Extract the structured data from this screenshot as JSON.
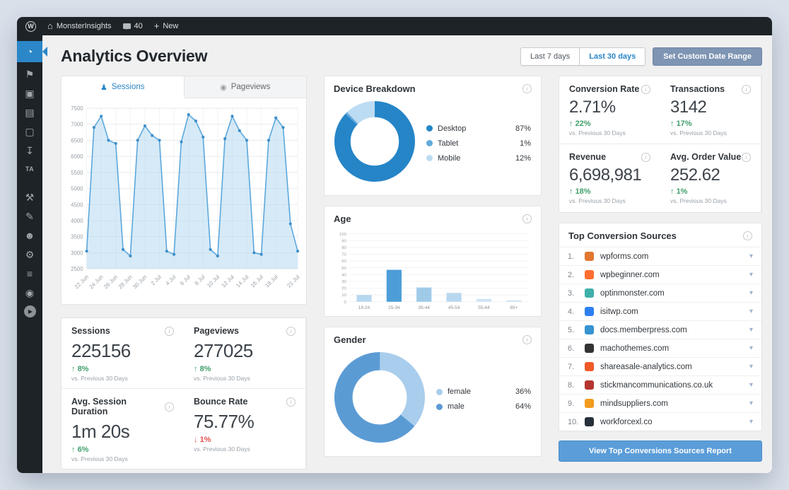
{
  "admin_bar": {
    "site_name": "MonsterInsights",
    "comments_count": "40",
    "new_label": "New"
  },
  "sidebar": {
    "items": [
      {
        "name": "monsterinsights",
        "glyph": "◔",
        "state": "active"
      },
      {
        "name": "posts-pin",
        "glyph": "⚑",
        "state": ""
      },
      {
        "name": "media",
        "glyph": "▣",
        "state": ""
      },
      {
        "name": "pages",
        "glyph": "▤",
        "state": ""
      },
      {
        "name": "comments",
        "glyph": "▢",
        "state": ""
      },
      {
        "name": "downloads",
        "glyph": "↧",
        "state": ""
      },
      {
        "name": "ta-plugin",
        "glyph": "TA",
        "state": "ta"
      },
      {
        "name": "tools",
        "glyph": "⚒",
        "state": "spaced"
      },
      {
        "name": "design",
        "glyph": "✎",
        "state": ""
      },
      {
        "name": "users",
        "glyph": "☻",
        "state": ""
      },
      {
        "name": "settings",
        "glyph": "⚙",
        "state": ""
      },
      {
        "name": "modules",
        "glyph": "≡",
        "state": ""
      },
      {
        "name": "addon",
        "glyph": "◉",
        "state": ""
      },
      {
        "name": "video",
        "glyph": "▶",
        "state": "round"
      }
    ]
  },
  "header": {
    "title": "Analytics Overview",
    "range_buttons": [
      {
        "label": "Last 7 days",
        "active": false
      },
      {
        "label": "Last 30 days",
        "active": true
      }
    ],
    "custom_range_label": "Set Custom Date Range"
  },
  "tabs": [
    {
      "label": "Sessions"
    },
    {
      "label": "Pageviews"
    }
  ],
  "chart_data": [
    {
      "type": "area",
      "title": "Sessions",
      "values": [
        3050,
        6900,
        7250,
        6500,
        6400,
        3100,
        2900,
        6500,
        6950,
        6650,
        6500,
        3050,
        2950,
        6450,
        7300,
        7100,
        6600,
        3100,
        2900,
        6550,
        7250,
        6800,
        6500,
        3000,
        2950,
        6500,
        7200,
        6900,
        3900,
        3050
      ],
      "ylim": [
        2500,
        7500
      ],
      "yticks": [
        2500,
        3000,
        3500,
        4000,
        4500,
        5000,
        5500,
        6000,
        6500,
        7000,
        7500
      ],
      "xtick_labels": [
        "22 Jun",
        "24 Jun",
        "26 Jun",
        "28 Jun",
        "30 Jun",
        "2 Jul",
        "4 Jul",
        "6 Jul",
        "8 Jul",
        "10 Jul",
        "12 Jul",
        "14 Jul",
        "16 Jul",
        "18 Jul",
        "21 Jul"
      ],
      "xtick_positions": [
        0,
        2,
        4,
        6,
        8,
        10,
        12,
        14,
        16,
        18,
        20,
        22,
        24,
        26,
        29
      ],
      "grid": true,
      "legend_position": "none",
      "line_color": "#5ba7dc",
      "fill_color": "rgba(180,216,241,0.55)",
      "point_color": "#3e8ec9"
    },
    {
      "type": "pie",
      "title": "Device Breakdown",
      "labels": [
        "Desktop",
        "Tablet",
        "Mobile"
      ],
      "values": [
        87,
        1,
        12
      ],
      "colors": [
        "#2585c7",
        "#64aadd",
        "#bcdcf3"
      ],
      "legend_position": "right"
    },
    {
      "type": "bar",
      "title": "Age",
      "categories": [
        "18-24",
        "25-34",
        "35-44",
        "45-54",
        "55-64",
        "65+"
      ],
      "values": [
        10,
        47,
        21,
        13,
        4,
        2
      ],
      "ylim": [
        0,
        100
      ],
      "yticks": [
        0,
        10,
        20,
        30,
        40,
        50,
        60,
        70,
        80,
        90,
        100
      ],
      "grid": true,
      "colors": [
        "#b8d8f0",
        "#4d9ed8",
        "#9fcbe9",
        "#b8d8f0",
        "#cfe4f5",
        "#cfe4f5"
      ]
    },
    {
      "type": "pie",
      "title": "Gender",
      "labels": [
        "female",
        "male"
      ],
      "values": [
        36,
        64
      ],
      "colors": [
        "#a9cdec",
        "#5b9bd4"
      ],
      "legend_position": "right"
    }
  ],
  "stats": [
    {
      "label": "Sessions",
      "value": "225156",
      "arrow": "↑",
      "change": "8%",
      "dir": "up",
      "note": "vs. Previous 30 Days"
    },
    {
      "label": "Pageviews",
      "value": "277025",
      "arrow": "↑",
      "change": "8%",
      "dir": "up",
      "note": "vs. Previous 30 Days"
    },
    {
      "label": "Avg. Session Duration",
      "value": "1m 20s",
      "arrow": "↑",
      "change": "6%",
      "dir": "up",
      "note": "vs. Previous 30 Days"
    },
    {
      "label": "Bounce Rate",
      "value": "75.77%",
      "arrow": "↓",
      "change": "1%",
      "dir": "down",
      "note": "vs. Previous 30 Days"
    }
  ],
  "kpis": [
    {
      "label": "Conversion Rate",
      "value": "2.71%",
      "arrow": "↑",
      "change": "22%",
      "dir": "up",
      "note": "vs. Previous 30 Days"
    },
    {
      "label": "Transactions",
      "value": "3142",
      "arrow": "↑",
      "change": "17%",
      "dir": "up",
      "note": "vs. Previous 30 Days"
    },
    {
      "label": "Revenue",
      "value": "6,698,981",
      "arrow": "↑",
      "change": "18%",
      "dir": "up",
      "note": "vs. Previous 30 Days"
    },
    {
      "label": "Avg. Order Value",
      "value": "252.62",
      "arrow": "↑",
      "change": "1%",
      "dir": "up",
      "note": "vs. Previous 30 Days"
    }
  ],
  "top_sources": {
    "title": "Top Conversion Sources",
    "rows": [
      {
        "rank": "1.",
        "domain": "wpforms.com",
        "favicon_color": "#e27730"
      },
      {
        "rank": "2.",
        "domain": "wpbeginner.com",
        "favicon_color": "#ff6e30"
      },
      {
        "rank": "3.",
        "domain": "optinmonster.com",
        "favicon_color": "#3eb0a8"
      },
      {
        "rank": "4.",
        "domain": "isitwp.com",
        "favicon_color": "#2d7ff0"
      },
      {
        "rank": "5.",
        "domain": "docs.memberpress.com",
        "favicon_color": "#3693d1"
      },
      {
        "rank": "6.",
        "domain": "machothemes.com",
        "favicon_color": "#333333"
      },
      {
        "rank": "7.",
        "domain": "shareasale-analytics.com",
        "favicon_color": "#f05a28"
      },
      {
        "rank": "8.",
        "domain": "stickmancommunications.co.uk",
        "favicon_color": "#b5352f"
      },
      {
        "rank": "9.",
        "domain": "mindsuppliers.com",
        "favicon_color": "#f29b1d"
      },
      {
        "rank": "10.",
        "domain": "workforcexl.co",
        "favicon_color": "#27313c"
      }
    ],
    "button_label": "View Top Conversions Sources Report"
  }
}
